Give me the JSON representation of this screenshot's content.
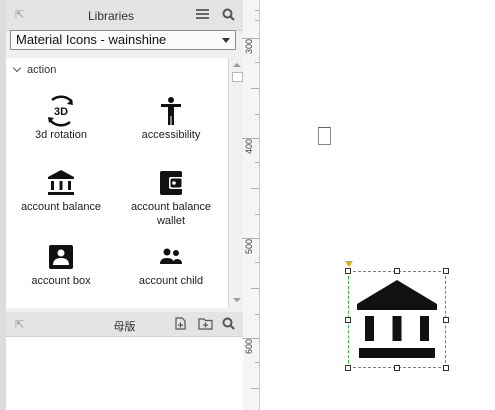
{
  "libraries_panel": {
    "title": "Libraries",
    "selected_library": "Material Icons - wainshine",
    "section": "action",
    "items": [
      {
        "label": "3d rotation",
        "icon": "3d-rotation-icon"
      },
      {
        "label": "accessibility",
        "icon": "accessibility-icon"
      },
      {
        "label": "account balance",
        "icon": "account-balance-icon"
      },
      {
        "label": "account balance\nwallet",
        "icon": "account-balance-wallet-icon"
      },
      {
        "label": "account box",
        "icon": "account-box-icon"
      },
      {
        "label": "account child",
        "icon": "account-child-icon"
      }
    ],
    "badge_3d": "3D"
  },
  "masters_panel": {
    "title": "母版"
  },
  "ruler": {
    "labels": [
      "300",
      "400",
      "500",
      "600"
    ]
  },
  "colors": {
    "selection": "#2fb52f",
    "anchor": "#e0b000",
    "panel_bg": "#f0f0f0"
  }
}
